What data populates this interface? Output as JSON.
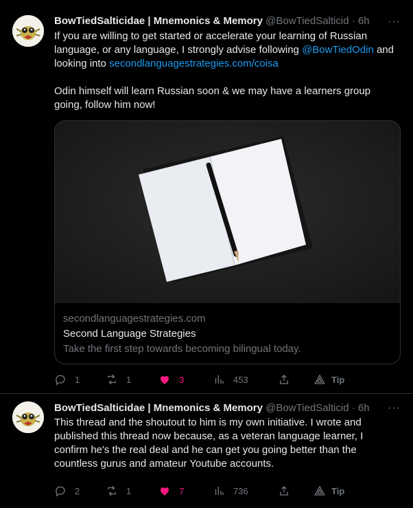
{
  "tweets": [
    {
      "author_name": "BowTiedSalticidae | Mnemonics & Memory",
      "author_handle": "@BowTiedSalticid",
      "separator": "·",
      "time": "6h",
      "more": "···",
      "text_line1": "If you are willing to get started or accelerate your learning of Russian",
      "text_line2_a": "language, or any language, I strongly advise following ",
      "mention": "@BowTiedOdin",
      "text_line2_b": " and",
      "text_line3_a": "looking into ",
      "url": "secondlanguagestrategies.com/coisa",
      "text_line4": "Odin himself will learn Russian soon & we may have a learners group",
      "text_line5": "going, follow him now!",
      "card": {
        "domain": "secondlanguagestrategies.com",
        "title": "Second Language Strategies",
        "description": "Take the first step towards becoming bilingual today."
      },
      "actions": {
        "replies": "1",
        "retweets": "1",
        "likes": "3",
        "views": "453",
        "tip": "Tip"
      }
    },
    {
      "author_name": "BowTiedSalticidae | Mnemonics & Memory",
      "author_handle": "@BowTiedSalticid",
      "separator": "·",
      "time": "6h",
      "more": "···",
      "text_line1": "This thread and the shoutout to him is my own initiative. I wrote and",
      "text_line2": "published this thread now because, as a veteran language learner, I",
      "text_line3": "confirm he's the real deal and he can get you going better than the",
      "text_line4": "countless gurus and amateur Youtube accounts.",
      "actions": {
        "replies": "2",
        "retweets": "1",
        "likes": "7",
        "views": "736",
        "tip": "Tip"
      }
    }
  ],
  "colors": {
    "background": "#000000",
    "text": "#e7e9ea",
    "muted": "#71767b",
    "link": "#1d9bf0",
    "like": "#f91880",
    "border": "#2f3336"
  }
}
